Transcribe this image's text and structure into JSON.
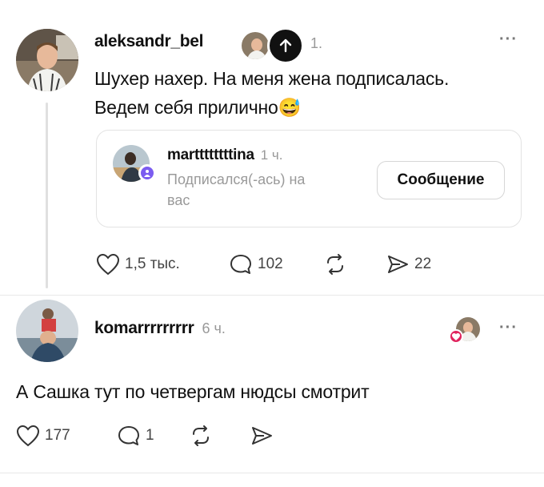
{
  "post": {
    "username": "aleksandr_bel",
    "time_partial": "1.",
    "text_line1": "Шухер нахер. На меня жена подписалась.",
    "text_line2": "Ведем себя прилично",
    "emoji": "😅",
    "more_label": "···",
    "card": {
      "username": "marttttttttina",
      "time": "1 ч.",
      "subtitle_line1": "Подписался(-ась) на",
      "subtitle_line2": "вас",
      "message_button": "Сообщение"
    },
    "actions": {
      "likes": "1,5 тыс.",
      "comments": "102",
      "shares": "22"
    }
  },
  "reply": {
    "username": "komarrrrrrrrr",
    "time": "6 ч.",
    "more_label": "···",
    "text": "А Сашка тут по четвергам нюдсы смотрит",
    "actions": {
      "likes": "177",
      "comments": "1"
    }
  },
  "icons": {
    "heart": "heart-icon",
    "comment": "comment-icon",
    "repost": "repost-icon",
    "share": "share-icon",
    "arrow_up": "arrow-up-icon"
  },
  "colors": {
    "text": "#111111",
    "muted": "#999999",
    "border": "#e3e3e3",
    "like_red": "#e0245e",
    "verified_purple": "#7b5cf0"
  }
}
